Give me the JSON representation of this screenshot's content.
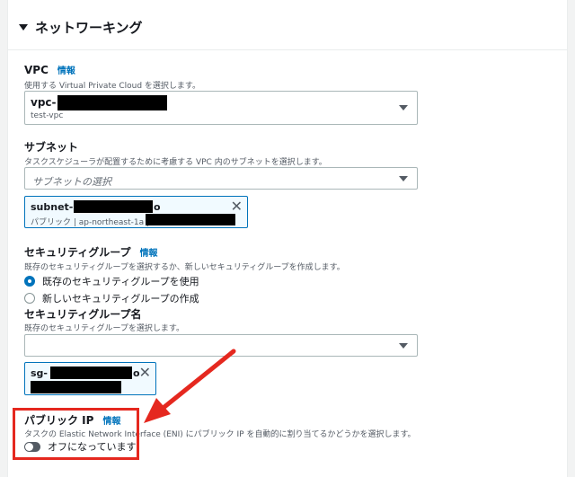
{
  "section": {
    "title": "ネットワーキング"
  },
  "vpc": {
    "label": "VPC",
    "info": "情報",
    "description": "使用する Virtual Private Cloud を選択します。",
    "value_prefix": "vpc-",
    "value_name": "test-vpc"
  },
  "subnet": {
    "label": "サブネット",
    "description": "タスクスケジューラが配置するために考慮する VPC 内のサブネットを選択します。",
    "placeholder": "サブネットの選択",
    "token_prefix": "subnet-",
    "token_suffix": "o",
    "token_detail": "パブリック | ap-northeast-1a |"
  },
  "security_group": {
    "label": "セキュリティグループ",
    "info": "情報",
    "description": "既存のセキュリティグループを選択するか、新しいセキュリティグループを作成します。",
    "option_existing": "既存のセキュリティグループを使用",
    "option_new": "新しいセキュリティグループの作成",
    "name_label": "セキュリティグループ名",
    "name_description": "既存のセキュリティグループを選択します。",
    "token_prefix": "sg-",
    "token_suffix": "o"
  },
  "public_ip": {
    "label": "パブリック IP",
    "info": "情報",
    "description": "タスクの Elastic Network Interface (ENI) にパブリック IP を自動的に割り当てるかどうかを選択します。",
    "toggle_label": "オフになっています",
    "toggle_on": false
  },
  "colors": {
    "link": "#0073bb",
    "annotation": "#e5281f"
  }
}
